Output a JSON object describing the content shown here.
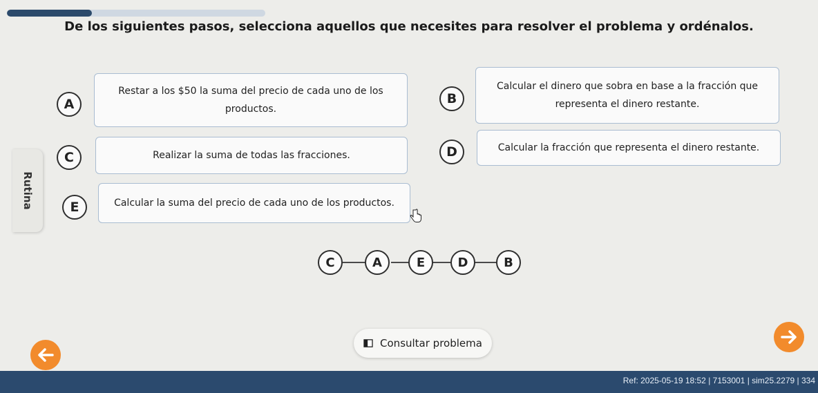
{
  "progress": {
    "fraction": 0.33
  },
  "instruction": "De los siguientes pasos, selecciona aquellos que necesites para resolver el problema y ordénalos.",
  "side_tab": {
    "label": "Rutina"
  },
  "options": [
    {
      "letter": "A",
      "text": "Restar a los $50 la suma del precio de cada uno de los productos."
    },
    {
      "letter": "B",
      "text": "Calcular el dinero que sobra en base a la fracción que representa el dinero restante."
    },
    {
      "letter": "C",
      "text": "Realizar la suma de todas las fracciones."
    },
    {
      "letter": "D",
      "text": "Calcular la fracción que representa el dinero restante."
    },
    {
      "letter": "E",
      "text": "Calcular la suma del precio de cada uno de los productos."
    }
  ],
  "sequence": [
    "C",
    "A",
    "E",
    "D",
    "B"
  ],
  "consult_button": {
    "label": "Consultar problema",
    "icon": "book-icon"
  },
  "nav": {
    "back_icon": "arrow-left-icon",
    "next_icon": "arrow-right-icon",
    "accent": "#f28b2c"
  },
  "footer": {
    "ref": "Ref: 2025-05-19 18:52 | 7153001 | sim25.2279 | 334"
  },
  "colors": {
    "footer": "#2b4a6e",
    "progress": "#2c4a6b",
    "option_border": "#a9bcd1"
  }
}
